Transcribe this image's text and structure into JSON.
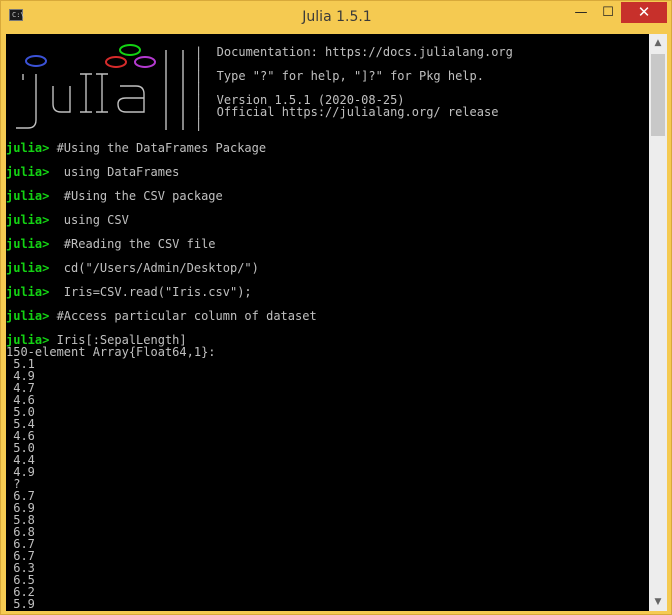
{
  "window": {
    "title": "Julia 1.5.1",
    "icon_label": "C:\\",
    "minimize_glyph": "—",
    "maximize_glyph": "☐",
    "close_glyph": "✕"
  },
  "banner": {
    "info_lines": [
      "|  Documentation: https://docs.julialang.org",
      "|",
      "|  Type \"?\" for help, \"]?\" for Pkg help.",
      "|",
      "|  Version 1.5.1 (2020-08-25)",
      "|  Official https://julialang.org/ release",
      "|"
    ],
    "logo_colors": [
      "#3b52d6",
      "#13d313",
      "#d62b2b",
      "#b43ad0"
    ]
  },
  "session": {
    "prompt": "julia>",
    "commands": [
      " #Using the DataFrames Package",
      "  using DataFrames",
      "  #Using the CSV package",
      "  using CSV",
      "  #Reading the CSV file",
      "  cd(\"/Users/Admin/Desktop/\")",
      "  Iris=CSV.read(\"Iris.csv\");",
      " #Access particular column of dataset",
      " Iris[:SepalLength]"
    ],
    "output_header": "150-element Array{Float64,1}:",
    "values": [
      " 5.1",
      " 4.9",
      " 4.7",
      " 4.6",
      " 5.0",
      " 5.4",
      " 4.6",
      " 5.0",
      " 4.4",
      " 4.9",
      " ?",
      " 6.7",
      " 6.9",
      " 5.8",
      " 6.8",
      " 6.7",
      " 6.7",
      " 6.3",
      " 6.5",
      " 6.2",
      " 5.9"
    ]
  },
  "scrollbar": {
    "up_glyph": "▲",
    "down_glyph": "▼"
  }
}
